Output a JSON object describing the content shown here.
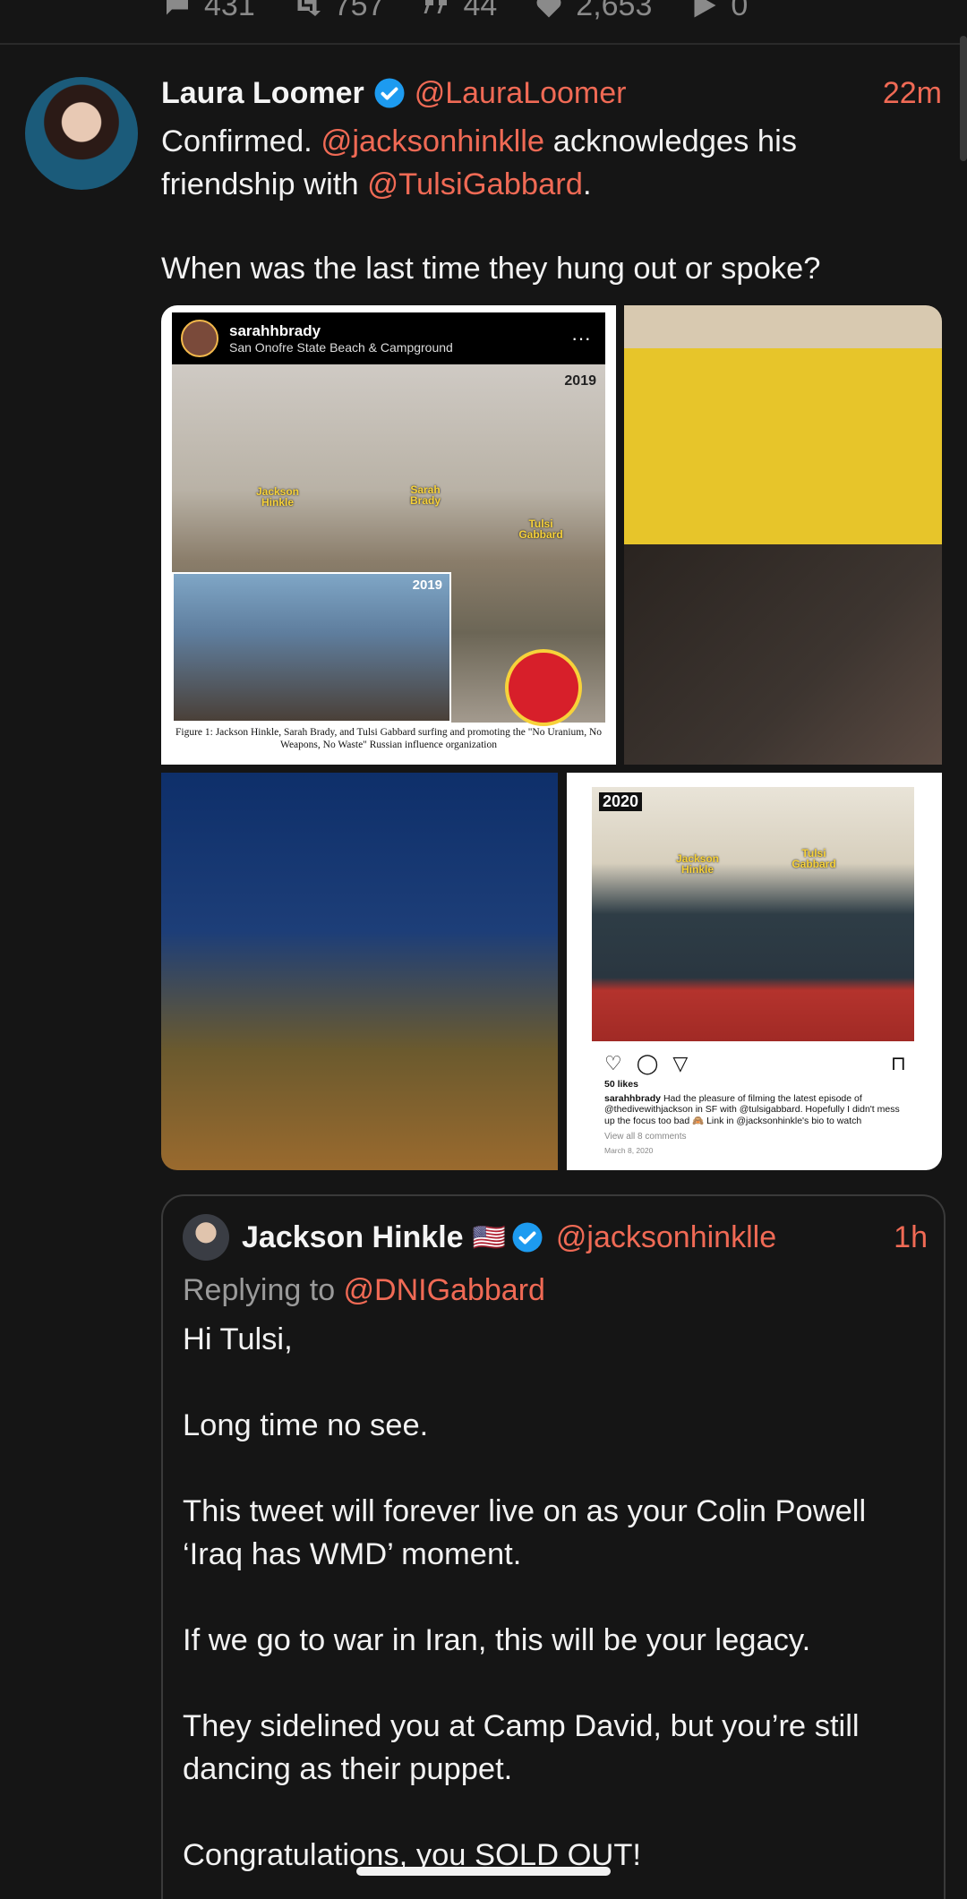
{
  "stats": {
    "replies": "431",
    "reposts": "757",
    "quotes": "44",
    "likes": "2,653",
    "views": "0"
  },
  "tweet": {
    "author_name": "Laura Loomer",
    "handle": "@LauraLoomer",
    "time": "22m",
    "text_part1": "Confirmed. ",
    "mention1": "@jacksonhinklle",
    "text_part2": " acknowledges his friendship with ",
    "mention2": "@TulsiGabbard",
    "text_part3": ".",
    "text_question": "When was the last time they hung out or spoke?"
  },
  "media": {
    "img1": {
      "ig_user": "sarahhbrady",
      "ig_location": "San Onofre State Beach & Campground",
      "year": "2019",
      "year_inset": "2019",
      "label_jackson": "Jackson Hinkle",
      "label_sarah": "Sarah Brady",
      "label_tulsi": "Tulsi Gabbard",
      "caption": "Figure 1: Jackson Hinkle, Sarah Brady, and Tulsi Gabbard surfing and promoting the \"No Uranium, No Weapons, No Waste\" Russian influence organization"
    },
    "img5": {
      "year": "2020",
      "label_jackson": "Jackson Hinkle",
      "label_tulsi": "Tulsi Gabbard",
      "likes": "50 likes",
      "caption_user": "sarahhbrady",
      "caption_text": "Had the pleasure of filming the latest episode of @thedivewithjackson in SF with @tulsigabbard. Hopefully I didn't mess up the focus too bad 🙈 Link in @jacksonhinkle's bio to watch",
      "view_comments": "View all 8 comments",
      "date": "March 8, 2020"
    }
  },
  "quoted": {
    "author_name": "Jackson Hinkle",
    "flag": "🇺🇸",
    "handle": "@jacksonhinklle",
    "time": "1h",
    "replying_prefix": "Replying to ",
    "replying_handle": "@DNIGabbard",
    "body": "Hi Tulsi,\n\nLong time no see.\n\nThis tweet will forever live on as your Colin Powell ‘Iraq has WMD’ moment.\n\nIf we go to war in Iran, this will be your legacy.\n\nThey sidelined you at Camp David, but you’re still dancing as their puppet.\n\nCongratulations, you SOLD OUT!"
  },
  "colors": {
    "background": "#151515",
    "accent": "#f06a55",
    "verified": "#1d9bf0"
  }
}
